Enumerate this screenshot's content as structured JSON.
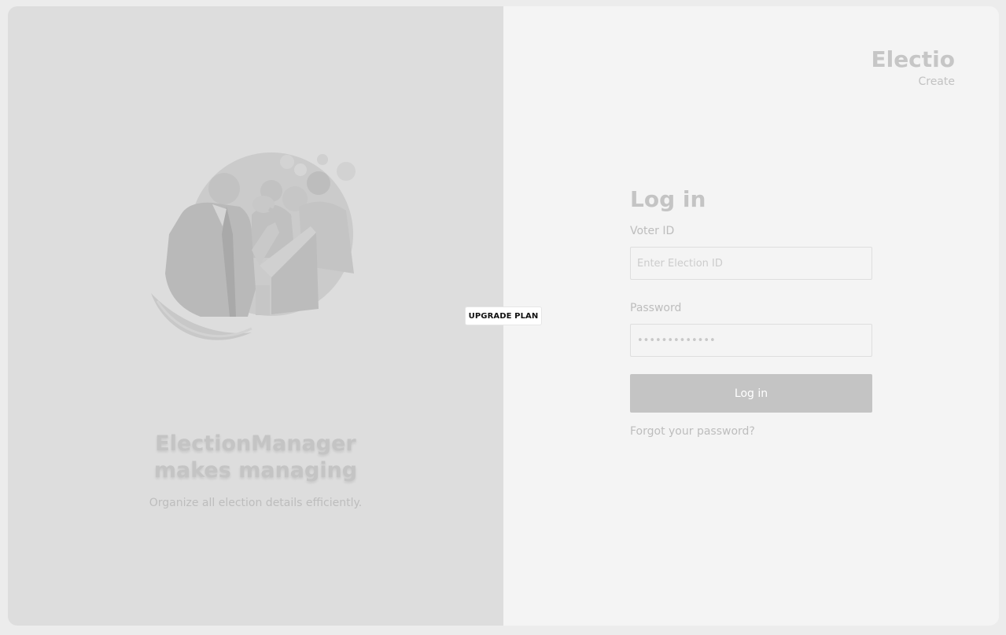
{
  "left": {
    "tagline_line1": "ElectionManager",
    "tagline_line2": "makes managing",
    "subtitle": "Organize all election details efficiently."
  },
  "upgrade": {
    "label": "UPGRADE PLAN"
  },
  "brand": {
    "title": "Electio",
    "subtitle": "Create"
  },
  "login": {
    "title": "Log in",
    "voter_id_label": "Voter ID",
    "voter_id_placeholder": "Enter Election ID",
    "password_label": "Password",
    "password_value": "•••••••••••••",
    "submit_label": "Log in",
    "forgot_label": "Forgot your password?"
  },
  "colors": {
    "left_bg": "#dddddd",
    "right_bg": "#f4f4f4",
    "button_bg": "#c4c4c4"
  },
  "icons": {
    "illustration": "politician-speech-illustration"
  }
}
